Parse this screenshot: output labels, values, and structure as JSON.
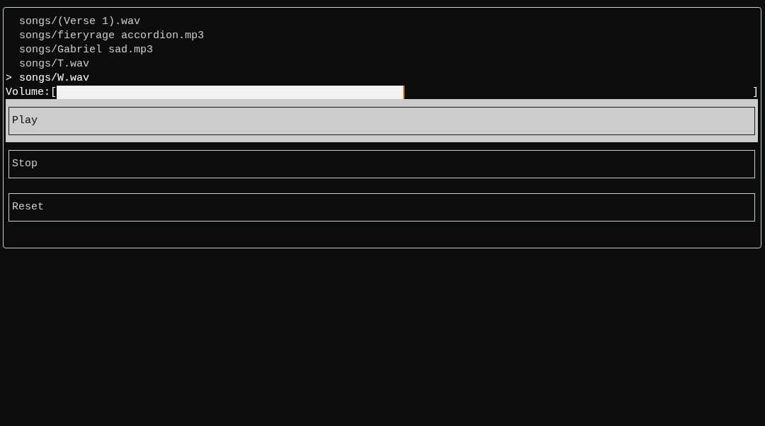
{
  "songs": [
    {
      "label": "songs/(Verse 1).wav",
      "selected": false
    },
    {
      "label": "songs/fieryrage accordion.mp3",
      "selected": false
    },
    {
      "label": "songs/Gabriel sad.mp3",
      "selected": false
    },
    {
      "label": "songs/T.wav",
      "selected": false
    },
    {
      "label": "songs/W.wav",
      "selected": true
    }
  ],
  "cursor": ">",
  "volume": {
    "label": "Volume:",
    "open_bracket": "[",
    "close_bracket": "]",
    "level": 0.5
  },
  "buttons": [
    {
      "label": "Play",
      "focused": true
    },
    {
      "label": "Stop",
      "focused": false
    },
    {
      "label": "Reset",
      "focused": false
    }
  ]
}
